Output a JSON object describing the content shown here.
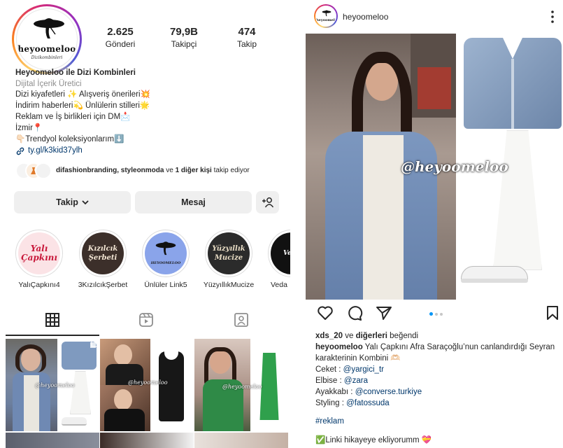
{
  "profile": {
    "brand_logo_text": "heyoomeloo",
    "brand_logo_sub": "Dizikombinleri",
    "stats": [
      {
        "value": "2.625",
        "label": "Gönderi"
      },
      {
        "value": "79,9B",
        "label": "Takipçi"
      },
      {
        "value": "474",
        "label": "Takip"
      }
    ],
    "bio": {
      "name": "Heyoomeloo ile Dizi Kombinleri",
      "category": "Dijital İçerik Üretici",
      "lines": [
        "Dizi kiyafetleri ✨ Alışveriş önerileri💥",
        "İndirim haberleri💫 Ünlülerin stilleri🌟",
        "Reklam ve İş birlikleri için DM📩",
        "İzmir📍",
        "👇🏻Trendyol koleksiyonlarım⬇️"
      ],
      "link": "ty.gl/k3kid37ylh"
    },
    "followed_by": {
      "names": "difashionbranding, styleonmoda",
      "and": " ve ",
      "others": "1 diğer kişi",
      "suffix": " takip ediyor"
    },
    "buttons": {
      "follow": "Takip",
      "message": "Mesaj"
    },
    "highlights": [
      {
        "label": "YalıÇapkını4",
        "art": "Yalı\nÇapkını",
        "bg": "#fbe3e6",
        "fg": "#c8183a"
      },
      {
        "label": "3KızılcıkŞerbet",
        "art": "Kızılcık\nŞerbeti",
        "bg": "#3c2f2a",
        "fg": "#f3e6d4"
      },
      {
        "label": "Ünlüler Link5",
        "art": "HEYOOMELOO",
        "bg": "#8aa4ea",
        "fg": "#1a1a1a"
      },
      {
        "label": "YüzyıllıkMucize",
        "art": "Yüzyıllık\nMucize",
        "bg": "#2b2b2b",
        "fg": "#e8dcc4"
      },
      {
        "label": "Veda",
        "art": "Veda",
        "bg": "#111111",
        "fg": "#ffffff"
      }
    ],
    "watermarks": [
      "@heyoomeloo",
      "@heyoomeloo",
      "@heyoomeloo"
    ]
  },
  "post": {
    "username": "heyoomeloo",
    "avatar_text": "heyoomeloo",
    "watermark": "@heyoomeloo",
    "liked_by_user": "xds_20",
    "liked_by_mid": " ve ",
    "liked_by_others": "diğerleri",
    "liked_by_suffix": " beğendi",
    "caption_user": "heyoomeloo",
    "caption_text": " Yalı Çapkını Afra Saraçoğlu’nun canlandırdığı Seyran",
    "caption_line2": "karakterinin Kombini 🫶🏻",
    "credits": [
      {
        "label": "Ceket : ",
        "mention": "@yargici_tr"
      },
      {
        "label": "Elbise : ",
        "mention": "@zara"
      },
      {
        "label": "Ayakkabı : ",
        "mention": "@converse.turkiye"
      },
      {
        "label": "Styling : ",
        "mention": "@fatossuda"
      }
    ],
    "hashtag": "#reklam",
    "footer": "✅Linki hikayeye ekliyorumm 💝"
  },
  "colors": {
    "accent_blue": "#0095f6",
    "link": "#00376b",
    "text": "#262626",
    "muted": "#8e8e8e",
    "button_bg": "#efefef"
  }
}
